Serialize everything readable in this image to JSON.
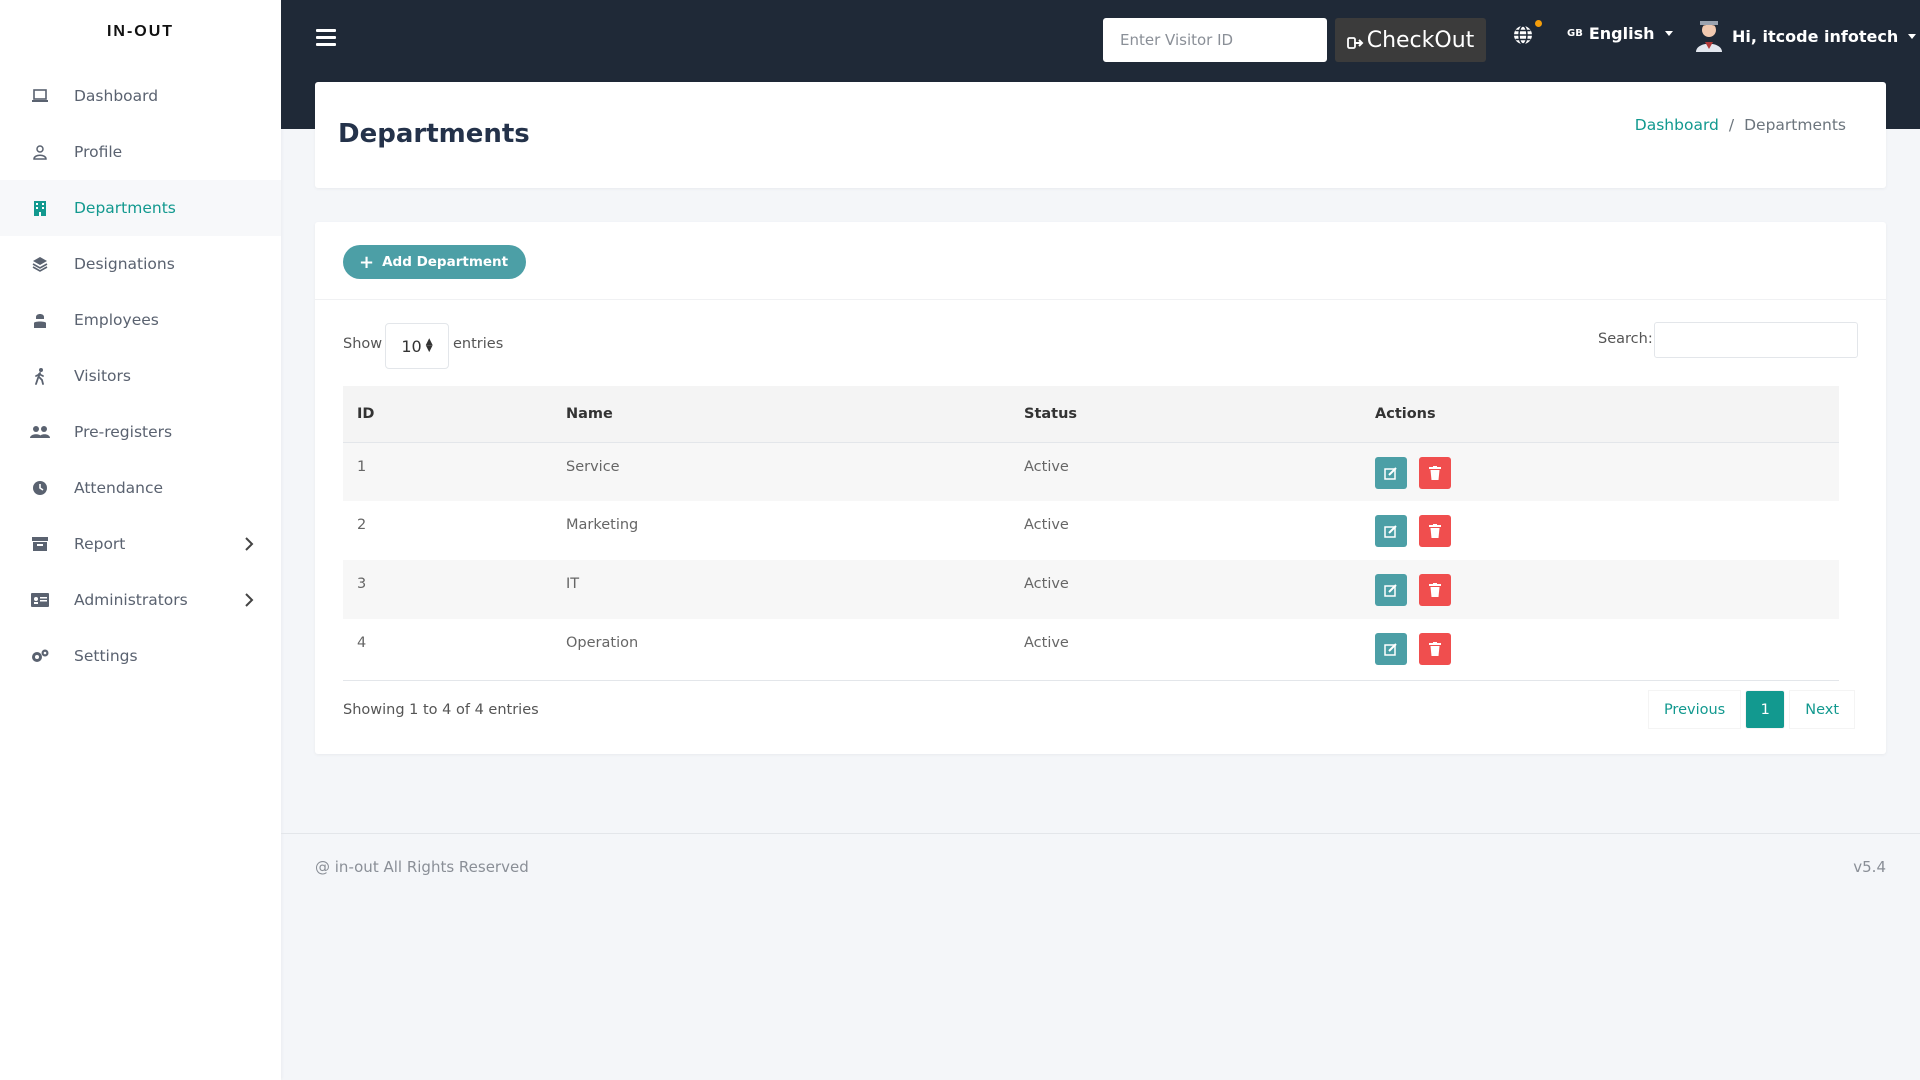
{
  "brand": "IN-OUT",
  "sidebar": {
    "items": [
      {
        "label": "Dashboard",
        "icon": "laptop-icon"
      },
      {
        "label": "Profile",
        "icon": "user-icon"
      },
      {
        "label": "Departments",
        "icon": "building-icon",
        "active": true
      },
      {
        "label": "Designations",
        "icon": "layers-icon"
      },
      {
        "label": "Employees",
        "icon": "employee-icon"
      },
      {
        "label": "Visitors",
        "icon": "walking-icon"
      },
      {
        "label": "Pre-registers",
        "icon": "users-icon"
      },
      {
        "label": "Attendance",
        "icon": "clock-icon"
      },
      {
        "label": "Report",
        "icon": "archive-icon",
        "has_children": true
      },
      {
        "label": "Administrators",
        "icon": "id-card-icon",
        "has_children": true
      },
      {
        "label": "Settings",
        "icon": "cogs-icon"
      }
    ]
  },
  "topbar": {
    "visitor_placeholder": "Enter Visitor ID",
    "checkout_label": "CheckOut",
    "language_flag": "GB",
    "language": "English",
    "user_greeting": "Hi, itcode infotech"
  },
  "page": {
    "title": "Departments",
    "breadcrumb": {
      "home": "Dashboard",
      "current": "Departments"
    }
  },
  "main": {
    "add_button": "Add Department",
    "show_label": "Show",
    "entries_value": "10",
    "entries_label": "entries",
    "search_label": "Search:",
    "columns": [
      "ID",
      "Name",
      "Status",
      "Actions"
    ],
    "rows": [
      {
        "id": "1",
        "name": "Service",
        "status": "Active"
      },
      {
        "id": "2",
        "name": "Marketing",
        "status": "Active"
      },
      {
        "id": "3",
        "name": "IT",
        "status": "Active"
      },
      {
        "id": "4",
        "name": "Operation",
        "status": "Active"
      }
    ],
    "info": "Showing 1 to 4 of 4 entries",
    "pagination": {
      "previous": "Previous",
      "current": "1",
      "next": "Next"
    }
  },
  "footer": {
    "copyright": "@ in-out All Rights Reserved",
    "version": "v5.4"
  },
  "colors": {
    "accent": "#12998f",
    "topbar": "#1f2937",
    "edit": "#4c9fa6",
    "delete": "#f04e4e"
  }
}
